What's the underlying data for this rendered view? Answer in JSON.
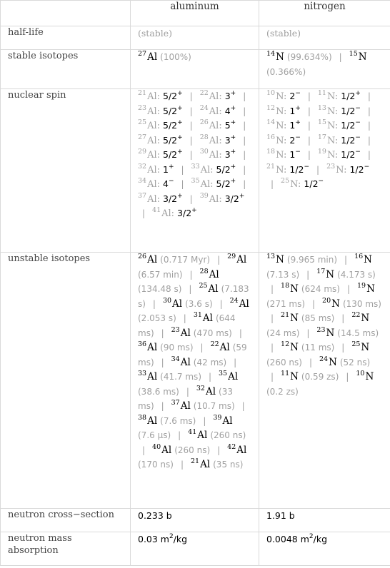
{
  "columns": [
    "",
    "aluminum",
    "nitrogen"
  ],
  "rows": {
    "half_life": {
      "label": "half-life",
      "aluminum": "(stable)",
      "nitrogen": "(stable)"
    },
    "stable_isotopes": {
      "label": "stable isotopes",
      "aluminum": [
        {
          "mass": "27",
          "symbol": "Al",
          "abundance": "(100%)"
        }
      ],
      "nitrogen": [
        {
          "mass": "14",
          "symbol": "N",
          "abundance": "(99.634%)"
        },
        {
          "mass": "15",
          "symbol": "N",
          "abundance": "(0.366%)"
        }
      ]
    },
    "nuclear_spin": {
      "label": "nuclear spin",
      "aluminum": [
        {
          "mass": "21",
          "symbol": "Al:",
          "spin": "5/2",
          "parity": "+"
        },
        {
          "mass": "22",
          "symbol": "Al:",
          "spin": "3",
          "parity": "+"
        },
        {
          "mass": "23",
          "symbol": "Al:",
          "spin": "5/2",
          "parity": "+"
        },
        {
          "mass": "24",
          "symbol": "Al:",
          "spin": "4",
          "parity": "+"
        },
        {
          "mass": "25",
          "symbol": "Al:",
          "spin": "5/2",
          "parity": "+"
        },
        {
          "mass": "26",
          "symbol": "Al:",
          "spin": "5",
          "parity": "+"
        },
        {
          "mass": "27",
          "symbol": "Al:",
          "spin": "5/2",
          "parity": "+"
        },
        {
          "mass": "28",
          "symbol": "Al:",
          "spin": "3",
          "parity": "+"
        },
        {
          "mass": "29",
          "symbol": "Al:",
          "spin": "5/2",
          "parity": "+"
        },
        {
          "mass": "30",
          "symbol": "Al:",
          "spin": "3",
          "parity": "+"
        },
        {
          "mass": "32",
          "symbol": "Al:",
          "spin": "1",
          "parity": "+"
        },
        {
          "mass": "33",
          "symbol": "Al:",
          "spin": "5/2",
          "parity": "+"
        },
        {
          "mass": "34",
          "symbol": "Al:",
          "spin": "4",
          "parity": "−"
        },
        {
          "mass": "35",
          "symbol": "Al:",
          "spin": "5/2",
          "parity": "+"
        },
        {
          "mass": "37",
          "symbol": "Al:",
          "spin": "3/2",
          "parity": "+"
        },
        {
          "mass": "39",
          "symbol": "Al:",
          "spin": "3/2",
          "parity": "+"
        },
        {
          "mass": "41",
          "symbol": "Al:",
          "spin": "3/2",
          "parity": "+"
        }
      ],
      "nitrogen": [
        {
          "mass": "10",
          "symbol": "N:",
          "spin": "2",
          "parity": "−"
        },
        {
          "mass": "11",
          "symbol": "N:",
          "spin": "1/2",
          "parity": "+"
        },
        {
          "mass": "12",
          "symbol": "N:",
          "spin": "1",
          "parity": "+"
        },
        {
          "mass": "13",
          "symbol": "N:",
          "spin": "1/2",
          "parity": "−"
        },
        {
          "mass": "14",
          "symbol": "N:",
          "spin": "1",
          "parity": "+"
        },
        {
          "mass": "15",
          "symbol": "N:",
          "spin": "1/2",
          "parity": "−"
        },
        {
          "mass": "16",
          "symbol": "N:",
          "spin": "2",
          "parity": "−"
        },
        {
          "mass": "17",
          "symbol": "N:",
          "spin": "1/2",
          "parity": "−"
        },
        {
          "mass": "18",
          "symbol": "N:",
          "spin": "1",
          "parity": "−"
        },
        {
          "mass": "19",
          "symbol": "N:",
          "spin": "1/2",
          "parity": "−"
        },
        {
          "mass": "21",
          "symbol": "N:",
          "spin": "1/2",
          "parity": "−"
        },
        {
          "mass": "23",
          "symbol": "N:",
          "spin": "1/2",
          "parity": "−"
        },
        {
          "mass": "25",
          "symbol": "N:",
          "spin": "1/2",
          "parity": "−"
        }
      ]
    },
    "unstable_isotopes": {
      "label": "unstable isotopes",
      "aluminum": [
        {
          "mass": "26",
          "symbol": "Al",
          "half_life": "(0.717 Myr)"
        },
        {
          "mass": "29",
          "symbol": "Al",
          "half_life": "(6.57 min)"
        },
        {
          "mass": "28",
          "symbol": "Al",
          "half_life": "(134.48 s)"
        },
        {
          "mass": "25",
          "symbol": "Al",
          "half_life": "(7.183 s)"
        },
        {
          "mass": "30",
          "symbol": "Al",
          "half_life": "(3.6 s)"
        },
        {
          "mass": "24",
          "symbol": "Al",
          "half_life": "(2.053 s)"
        },
        {
          "mass": "31",
          "symbol": "Al",
          "half_life": "(644 ms)"
        },
        {
          "mass": "23",
          "symbol": "Al",
          "half_life": "(470 ms)"
        },
        {
          "mass": "36",
          "symbol": "Al",
          "half_life": "(90 ms)"
        },
        {
          "mass": "22",
          "symbol": "Al",
          "half_life": "(59 ms)"
        },
        {
          "mass": "34",
          "symbol": "Al",
          "half_life": "(42 ms)"
        },
        {
          "mass": "33",
          "symbol": "Al",
          "half_life": "(41.7 ms)"
        },
        {
          "mass": "35",
          "symbol": "Al",
          "half_life": "(38.6 ms)"
        },
        {
          "mass": "32",
          "symbol": "Al",
          "half_life": "(33 ms)"
        },
        {
          "mass": "37",
          "symbol": "Al",
          "half_life": "(10.7 ms)"
        },
        {
          "mass": "38",
          "symbol": "Al",
          "half_life": "(7.6 ms)"
        },
        {
          "mass": "39",
          "symbol": "Al",
          "half_life": "(7.6 μs)"
        },
        {
          "mass": "41",
          "symbol": "Al",
          "half_life": "(260 ns)"
        },
        {
          "mass": "40",
          "symbol": "Al",
          "half_life": "(260 ns)"
        },
        {
          "mass": "42",
          "symbol": "Al",
          "half_life": "(170 ns)"
        },
        {
          "mass": "21",
          "symbol": "Al",
          "half_life": "(35 ns)"
        }
      ],
      "nitrogen": [
        {
          "mass": "13",
          "symbol": "N",
          "half_life": "(9.965 min)"
        },
        {
          "mass": "16",
          "symbol": "N",
          "half_life": "(7.13 s)"
        },
        {
          "mass": "17",
          "symbol": "N",
          "half_life": "(4.173 s)"
        },
        {
          "mass": "18",
          "symbol": "N",
          "half_life": "(624 ms)"
        },
        {
          "mass": "19",
          "symbol": "N",
          "half_life": "(271 ms)"
        },
        {
          "mass": "20",
          "symbol": "N",
          "half_life": "(130 ms)"
        },
        {
          "mass": "21",
          "symbol": "N",
          "half_life": "(85 ms)"
        },
        {
          "mass": "22",
          "symbol": "N",
          "half_life": "(24 ms)"
        },
        {
          "mass": "23",
          "symbol": "N",
          "half_life": "(14.5 ms)"
        },
        {
          "mass": "12",
          "symbol": "N",
          "half_life": "(11 ms)"
        },
        {
          "mass": "25",
          "symbol": "N",
          "half_life": "(260 ns)"
        },
        {
          "mass": "24",
          "symbol": "N",
          "half_life": "(52 ns)"
        },
        {
          "mass": "11",
          "symbol": "N",
          "half_life": "(0.59 zs)"
        },
        {
          "mass": "10",
          "symbol": "N",
          "half_life": "(0.2 zs)"
        }
      ]
    },
    "neutron_cross_section": {
      "label": "neutron cross−section",
      "aluminum": "0.233 b",
      "nitrogen": "1.91 b"
    },
    "neutron_mass_absorption": {
      "label": "neutron mass absorption",
      "aluminum": {
        "value": "0.03 m",
        "exp": "2",
        "unit": "/kg"
      },
      "nitrogen": {
        "value": "0.0048 m",
        "exp": "2",
        "unit": "/kg"
      }
    }
  },
  "separator": "|"
}
